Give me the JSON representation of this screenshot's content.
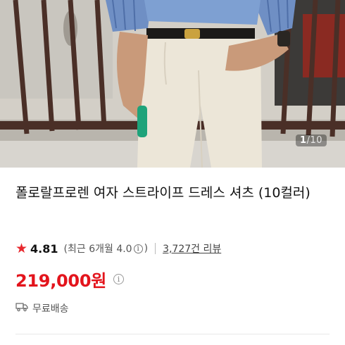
{
  "product_image": {
    "counter_current": "1",
    "counter_separator": "/",
    "counter_total": "10"
  },
  "product": {
    "title": "폴로랄프로렌 여자 스트라이프 드레스 셔츠 (10컬러)",
    "rating": "4.81",
    "recent_rating_prefix": "(최근 6개월 4.0",
    "recent_rating_suffix": ")",
    "reviews_link": "3,727건 리뷰",
    "price": "219,000원",
    "shipping": "무료배송"
  },
  "icons": {
    "star": "star-icon",
    "info": "info-icon",
    "truck": "truck-icon"
  },
  "colors": {
    "rating_star": "#e8282e",
    "price": "#e3141c"
  }
}
